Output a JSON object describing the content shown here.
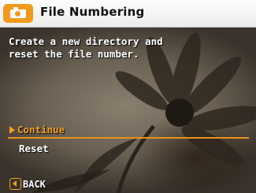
{
  "header": {
    "mode_icon": "camera-mode-icon",
    "title": "File Numbering"
  },
  "message": "Create a new directory and\nreset the file number.",
  "options": [
    {
      "label": "Continue",
      "selected": true
    },
    {
      "label": "Reset",
      "selected": false
    }
  ],
  "footer": {
    "back_icon": "back-arrow-icon",
    "back_label": "BACK"
  },
  "colors": {
    "accent": "#f0a020",
    "title_bar": "#f5f5f5",
    "text": "#ffffff"
  }
}
